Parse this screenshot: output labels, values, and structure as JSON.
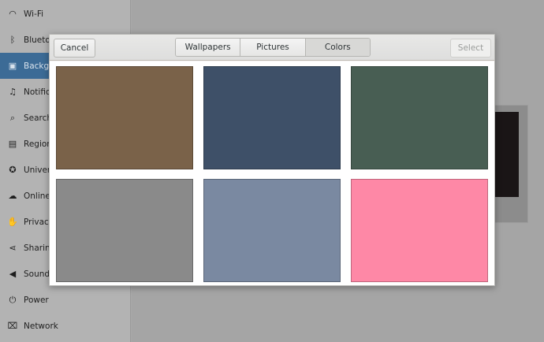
{
  "sidebar": {
    "items": [
      {
        "label": "Wi-Fi",
        "icon": "wifi-icon",
        "glyph": "◠",
        "active": false
      },
      {
        "label": "Bluetooth",
        "icon": "bluetooth-icon",
        "glyph": "ᛒ",
        "active": false
      },
      {
        "label": "Background",
        "icon": "background-icon",
        "glyph": "▣",
        "active": true
      },
      {
        "label": "Notifications",
        "icon": "bell-icon",
        "glyph": "🔔",
        "active": false
      },
      {
        "label": "Search",
        "icon": "search-icon",
        "glyph": "⌕",
        "active": false
      },
      {
        "label": "Region & Language",
        "icon": "region-icon",
        "glyph": "▤",
        "active": false
      },
      {
        "label": "Universal Access",
        "icon": "universal-access-icon",
        "glyph": "✪",
        "active": false
      },
      {
        "label": "Online Accounts",
        "icon": "online-accounts-icon",
        "glyph": "☁",
        "active": false
      },
      {
        "label": "Privacy",
        "icon": "privacy-hand-icon",
        "glyph": "✋",
        "active": false
      },
      {
        "label": "Sharing",
        "icon": "share-icon",
        "glyph": "⋖",
        "active": false
      },
      {
        "label": "Sound",
        "icon": "speaker-icon",
        "glyph": "◀",
        "active": false
      },
      {
        "label": "Power",
        "icon": "power-icon",
        "glyph": "⏻",
        "active": false
      },
      {
        "label": "Network",
        "icon": "network-icon",
        "glyph": "⌧",
        "active": false
      }
    ]
  },
  "dialog": {
    "cancel_label": "Cancel",
    "select_label": "Select",
    "tabs": [
      {
        "label": "Wallpapers",
        "active": false
      },
      {
        "label": "Pictures",
        "active": false
      },
      {
        "label": "Colors",
        "active": true
      }
    ],
    "colors": [
      "#7a6249",
      "#3e5068",
      "#485e53",
      "#8a8a8a",
      "#7a89a1",
      "#fe88a6"
    ]
  }
}
